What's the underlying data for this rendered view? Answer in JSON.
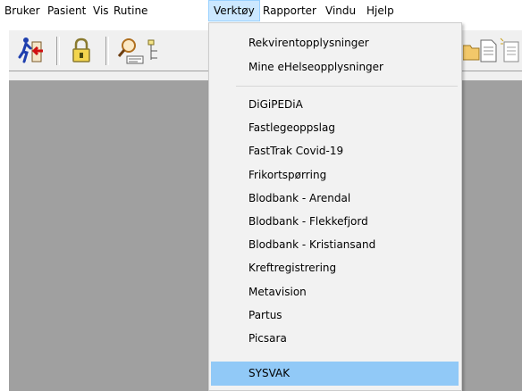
{
  "menubar": {
    "items": [
      {
        "label": "Bruker"
      },
      {
        "label": "Pasient"
      },
      {
        "label": "Vis"
      },
      {
        "label": "Rutine"
      },
      {
        "label": "Verktøy"
      },
      {
        "label": "Rapporter"
      },
      {
        "label": "Vindu"
      },
      {
        "label": "Hjelp"
      }
    ],
    "active": "Verktøy"
  },
  "toolbar": {
    "buttons": [
      {
        "icon": "exit-door-icon"
      },
      {
        "icon": "lock-icon"
      },
      {
        "icon": "search-patient-icon"
      },
      {
        "icon": "tree-icon"
      },
      {
        "icon": "folder-icon"
      },
      {
        "icon": "document-icon"
      },
      {
        "icon": "document-new-icon"
      }
    ]
  },
  "dropdown": {
    "groups": [
      [
        "Rekvirentopplysninger",
        "Mine eHelseopplysninger"
      ],
      [
        "DiGiPEDiA",
        "Fastlegeoppslag",
        "FastTrak Covid-19",
        "Frikortspørring",
        "Blodbank - Arendal",
        "Blodbank - Flekkefjord",
        "Blodbank - Kristiansand",
        "Kreftregistrering",
        "Metavision",
        "Partus",
        "Picsara",
        "SYSVAK"
      ]
    ],
    "highlighted": "SYSVAK"
  },
  "colors": {
    "menu_active_bg": "#cce8ff",
    "menu_highlight": "#91c9f7",
    "workspace": "#a0a0a0"
  }
}
